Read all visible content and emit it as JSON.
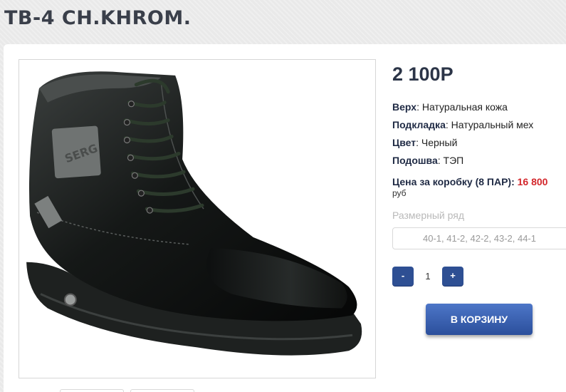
{
  "product": {
    "title": "TB-4 CH.KHROM.",
    "price": "2 100Р",
    "specs": [
      {
        "label": "Верх",
        "value": "Натуральная кожа"
      },
      {
        "label": "Подкладка",
        "value": "Натуральный мех"
      },
      {
        "label": "Цвет",
        "value": "Черный"
      },
      {
        "label": "Подошва",
        "value": "ТЭП"
      }
    ],
    "box_price_label": "Цена за коробку (8 ПАР):",
    "box_price_value": "16 800",
    "box_price_unit": "руб",
    "size_range_label": "Размерный ряд",
    "size_range_value": "40-1, 41-2, 42-2, 43-2, 44-1",
    "image_label": "SERG"
  },
  "quantity": {
    "minus_label": "-",
    "value": "1",
    "plus_label": "+"
  },
  "cart_button_label": "В КОРЗИНУ",
  "colors": {
    "accent": "#2e4f93",
    "price_red": "#d3262b"
  }
}
